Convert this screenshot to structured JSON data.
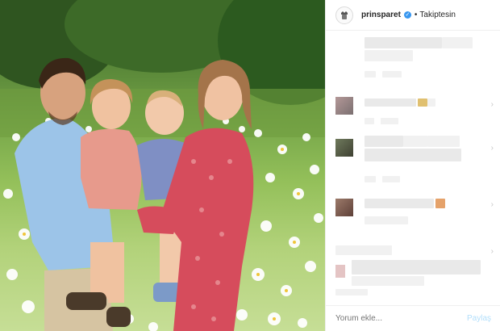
{
  "post": {
    "username": "prinsparet",
    "separator": "•",
    "follow_status": "Takiptesin"
  },
  "footer": {
    "comment_placeholder": "Yorum ekle...",
    "post_label": "Paylaş"
  },
  "icons": {
    "verified": "verified-badge-icon",
    "chevron": "chevron-right-icon"
  },
  "colors": {
    "accent": "#3897f0",
    "post_button_disabled": "#b2dffc"
  }
}
